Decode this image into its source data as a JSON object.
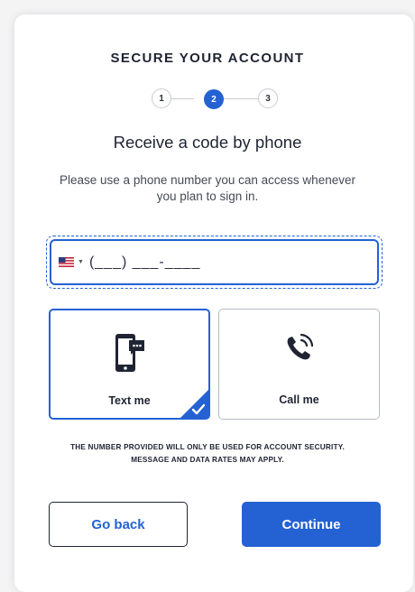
{
  "header": {
    "title": "SECURE YOUR ACCOUNT"
  },
  "stepper": {
    "steps": [
      "1",
      "2",
      "3"
    ],
    "current_step": 2
  },
  "main": {
    "heading": "Receive a code by phone",
    "description": "Please use a phone number you can access whenever you plan to sign in."
  },
  "phone": {
    "country": "us-flag-icon",
    "value": "(___) ___-____"
  },
  "options": {
    "text": {
      "label": "Text me",
      "icon": "mobile-message-icon",
      "selected": true
    },
    "call": {
      "label": "Call me",
      "icon": "phone-ringing-icon",
      "selected": false
    }
  },
  "disclaimer": "THE NUMBER PROVIDED WILL ONLY BE USED FOR ACCOUNT SECURITY. MESSAGE AND DATA RATES MAY APPLY.",
  "buttons": {
    "back": "Go back",
    "continue": "Continue"
  },
  "colors": {
    "accent": "#2462d3",
    "text": "#1f2433",
    "border": "#b7bcc5"
  }
}
